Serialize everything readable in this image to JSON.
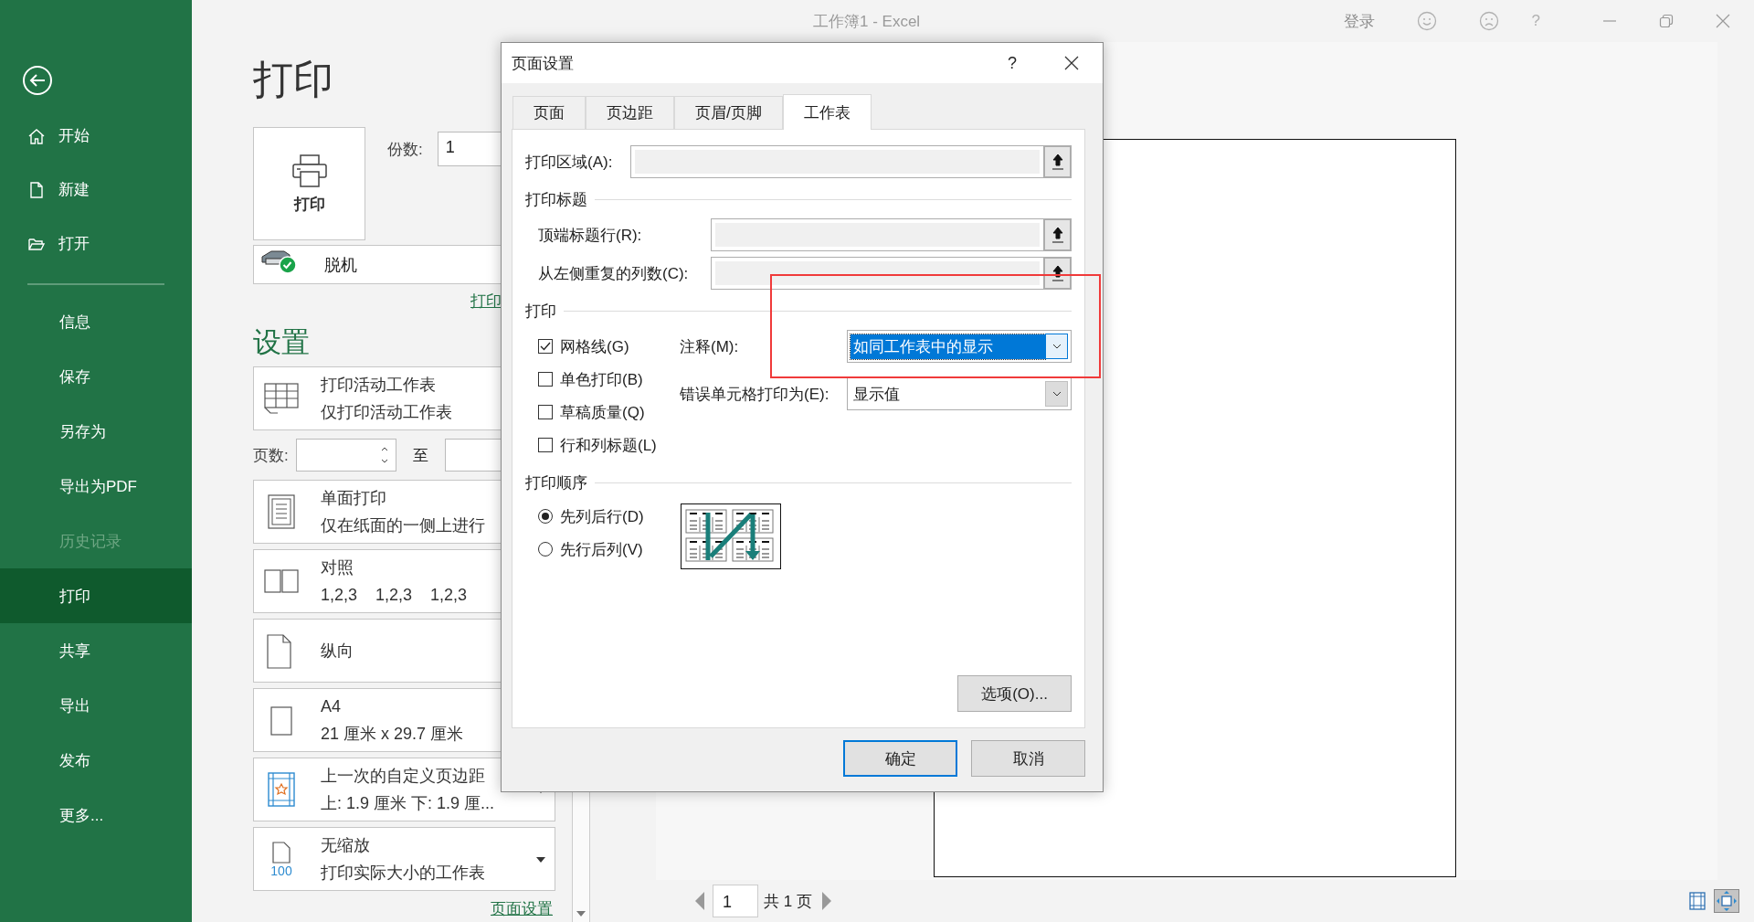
{
  "window": {
    "title": "工作簿1  -  Excel",
    "account": "登录",
    "help": "?"
  },
  "sidebar": {
    "nav": [
      {
        "label": "开始",
        "kind": "home"
      },
      {
        "label": "新建",
        "kind": "file"
      },
      {
        "label": "打开",
        "kind": "folder"
      }
    ],
    "items": [
      {
        "label": "信息",
        "selected": false,
        "disabled": false
      },
      {
        "label": "保存",
        "selected": false,
        "disabled": false
      },
      {
        "label": "另存为",
        "selected": false,
        "disabled": false
      },
      {
        "label": "导出为PDF",
        "selected": false,
        "disabled": false
      },
      {
        "label": "历史记录",
        "selected": false,
        "disabled": true
      },
      {
        "label": "打印",
        "selected": true,
        "disabled": false
      },
      {
        "label": "共享",
        "selected": false,
        "disabled": false
      },
      {
        "label": "导出",
        "selected": false,
        "disabled": false
      },
      {
        "label": "发布",
        "selected": false,
        "disabled": false
      },
      {
        "label": "更多...",
        "selected": false,
        "disabled": false
      }
    ]
  },
  "print": {
    "title": "打印",
    "print_button": "打印",
    "copies_label": "份数:",
    "copies": "1",
    "printer": "脱机",
    "printer_link": "打印",
    "settings_title": "设置",
    "settings": [
      {
        "kind": "option",
        "title": "打印活动工作表",
        "subtitle": "仅打印活动工作表"
      },
      {
        "kind": "pages",
        "label": "页数:",
        "to": "至"
      },
      {
        "kind": "option",
        "title": "单面打印",
        "subtitle": "仅在纸面的一侧上进行"
      },
      {
        "kind": "option",
        "title": "对照",
        "subtitle": "1,2,3    1,2,3    1,2,3"
      },
      {
        "kind": "option",
        "title": "纵向"
      },
      {
        "kind": "option",
        "title": "A4",
        "subtitle": "21 厘米 x 29.7 厘米"
      },
      {
        "kind": "dropdown",
        "title": "上一次的自定义页边距",
        "subtitle": "上: 1.9 厘米 下: 1.9 厘..."
      },
      {
        "kind": "dropdown",
        "icon_text": "100",
        "title": "无缩放",
        "subtitle": "打印实际大小的工作表"
      }
    ],
    "page_setup_link": "页面设置"
  },
  "preview": {
    "page": "1",
    "total": "共 1 页"
  },
  "dialog": {
    "title": "页面设置",
    "help": "?",
    "tabs": [
      {
        "label": "页面",
        "selected": false
      },
      {
        "label": "页边距",
        "selected": false
      },
      {
        "label": "页眉/页脚",
        "selected": false
      },
      {
        "label": "工作表",
        "selected": true
      }
    ],
    "print_area": "打印区域(A):",
    "titles_section": "打印标题",
    "title_rows": [
      {
        "label": "顶端标题行(R):"
      },
      {
        "label": "从左侧重复的列数(C):"
      }
    ],
    "print_section": "打印",
    "checkboxes": [
      {
        "label": "网格线(G)",
        "checked": true
      },
      {
        "label": "单色打印(B)",
        "checked": false
      },
      {
        "label": "草稿质量(Q)",
        "checked": false
      },
      {
        "label": "行和列标题(L)",
        "checked": false
      }
    ],
    "combos": [
      {
        "label": "注释(M):",
        "value": "如同工作表中的显示",
        "focused": true
      },
      {
        "label": "错误单元格打印为(E):",
        "value": "显示值",
        "focused": false
      }
    ],
    "order_section": "打印顺序",
    "order": [
      {
        "label": "先列后行(D)",
        "selected": true
      },
      {
        "label": "先行后列(V)",
        "selected": false
      }
    ],
    "options_button": "选项(O)...",
    "ok": "确定",
    "cancel": "取消"
  },
  "highlight": {
    "shown": true
  }
}
